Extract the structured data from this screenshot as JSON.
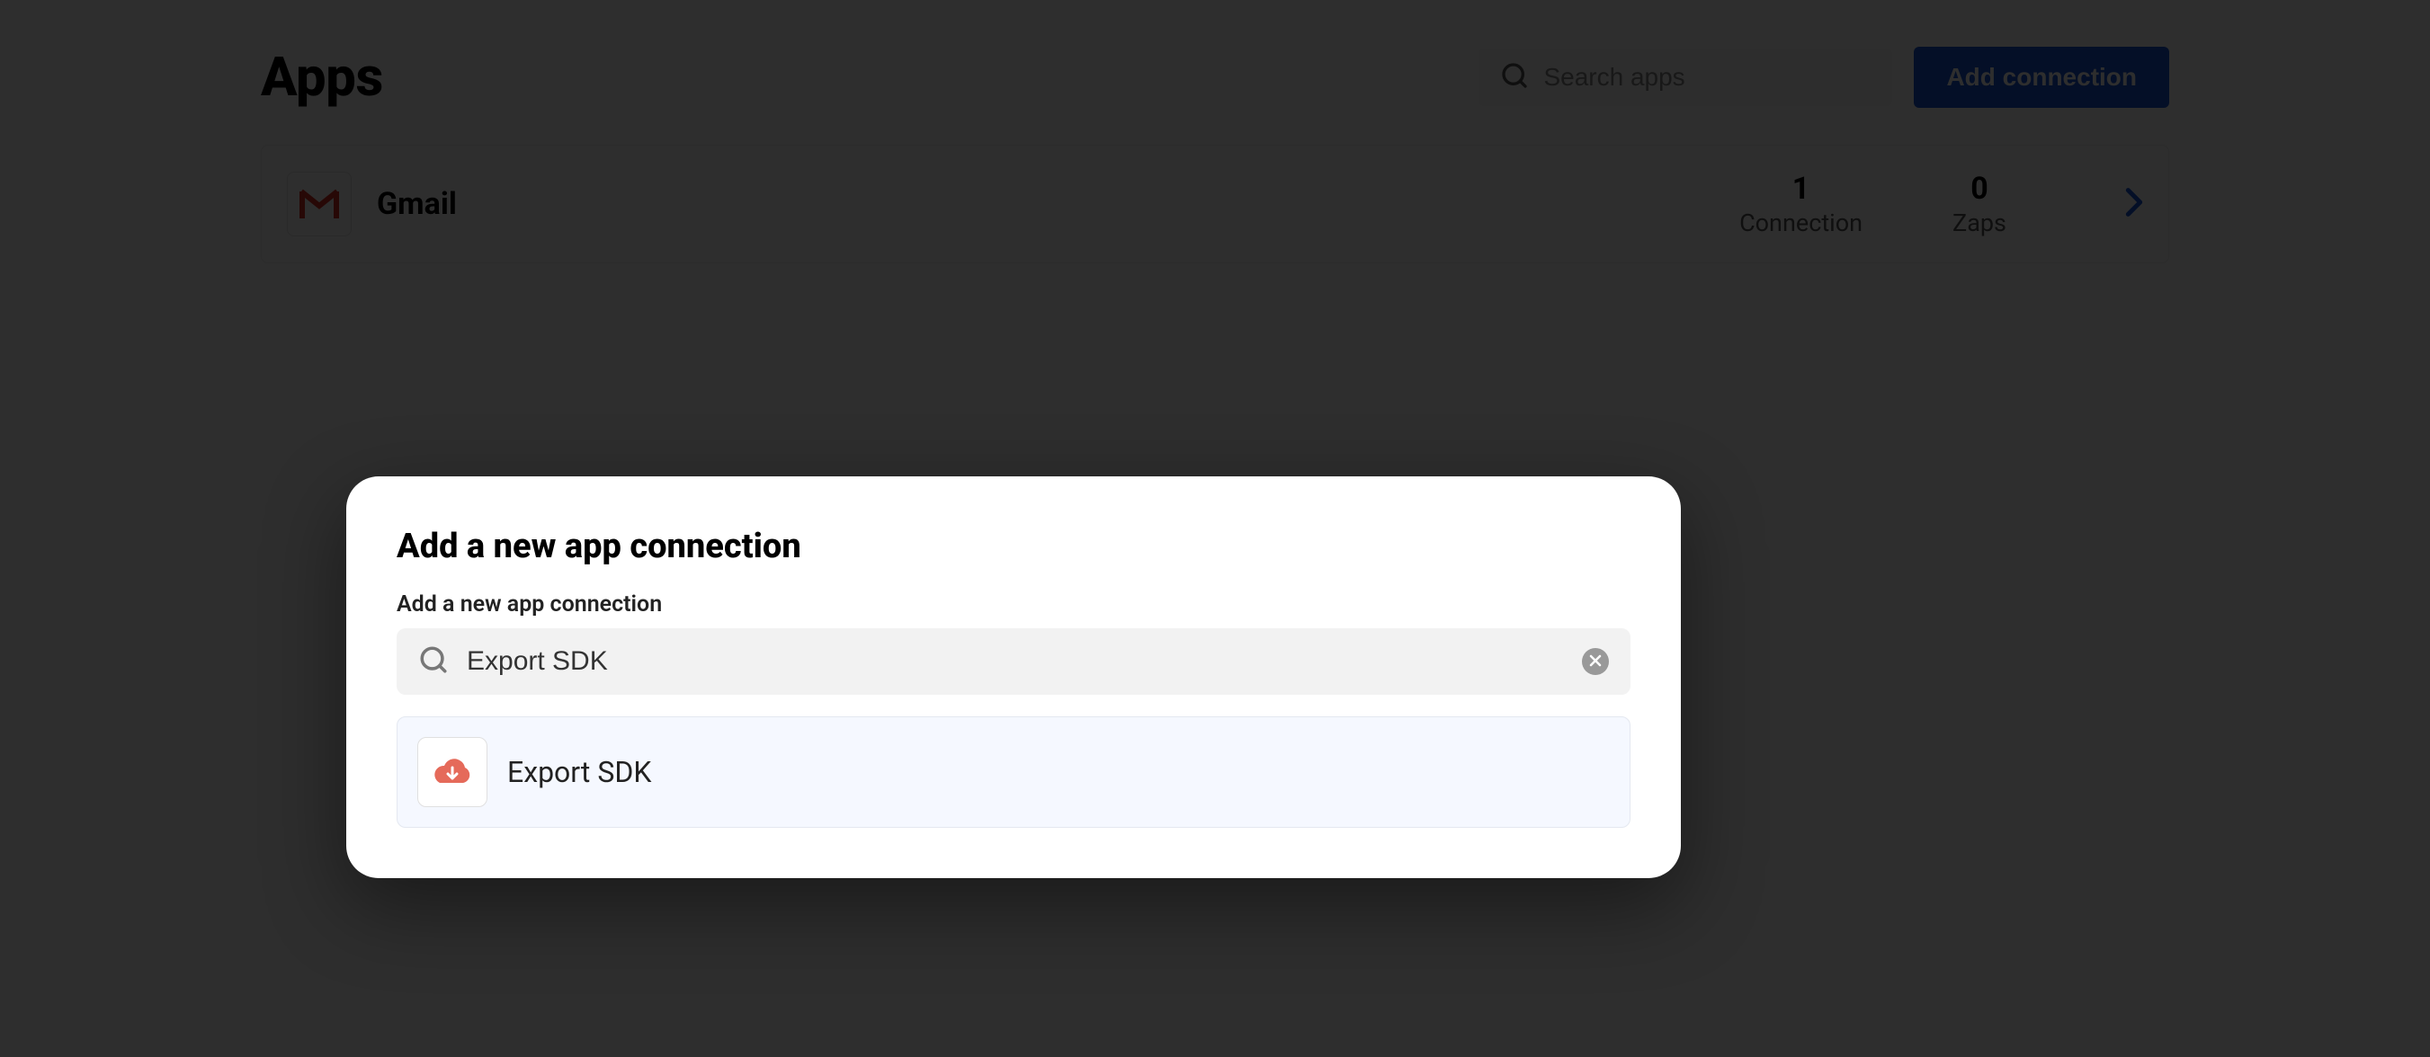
{
  "page": {
    "title": "Apps"
  },
  "header": {
    "search_placeholder": "Search apps",
    "add_connection_label": "Add connection"
  },
  "apps": [
    {
      "name": "Gmail",
      "connections_count": "1",
      "connections_label": "Connection",
      "zaps_count": "0",
      "zaps_label": "Zaps"
    }
  ],
  "modal": {
    "title": "Add a new app connection",
    "subtitle": "Add a new app connection",
    "search_value": "Export SDK",
    "results": [
      {
        "label": "Export SDK"
      }
    ]
  }
}
